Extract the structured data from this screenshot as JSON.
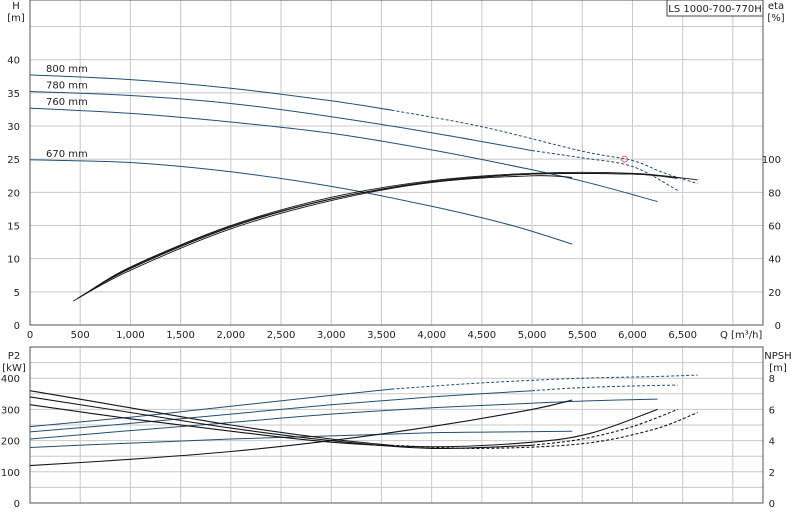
{
  "model_label": "LS 1000-700-770H",
  "colors": {
    "blue": "#1f4f7a",
    "black": "#151515",
    "grid": "#c8c8c8",
    "duty_point": "#e06666"
  },
  "chart_data": [
    {
      "type": "line",
      "name": "head-efficiency",
      "x_label": "Q [m³/h]",
      "x_ticks": [
        "0",
        "500",
        "1,000",
        "1,500",
        "2,000",
        "2,500",
        "3,000",
        "3,500",
        "4,000",
        "4,500",
        "5,000",
        "5,500",
        "6,000",
        "6,500"
      ],
      "xlim": [
        0,
        7300
      ],
      "left_axis": {
        "label_top": "H",
        "label_unit": "[m]",
        "ticks": [
          "0",
          "5",
          "10",
          "15",
          "20",
          "25",
          "30",
          "35",
          "40"
        ],
        "ylim": [
          0,
          49
        ]
      },
      "right_axis": {
        "label_top": "eta",
        "label_unit": "[%]",
        "ticks": [
          "0",
          "20",
          "40",
          "60",
          "80",
          "100"
        ],
        "ylim": [
          0,
          196
        ]
      },
      "grid": true,
      "head_curves": [
        {
          "name": "800 mm",
          "points": [
            [
              0,
              37.7
            ],
            [
              1000,
              37.0
            ],
            [
              2000,
              35.7
            ],
            [
              3000,
              33.8
            ],
            [
              3600,
              32.4
            ],
            [
              4500,
              29.9
            ],
            [
              5500,
              26.2
            ],
            [
              6000,
              24.8
            ],
            [
              6300,
              23.0
            ],
            [
              6650,
              21.3
            ]
          ],
          "solid_until": 3600
        },
        {
          "name": "780 mm",
          "points": [
            [
              0,
              35.2
            ],
            [
              1000,
              34.6
            ],
            [
              2000,
              33.4
            ],
            [
              3000,
              31.4
            ],
            [
              4000,
              29.0
            ],
            [
              5000,
              26.3
            ],
            [
              5500,
              25.2
            ],
            [
              6000,
              23.9
            ],
            [
              6450,
              20.3
            ]
          ],
          "solid_until": 5000
        },
        {
          "name": "760 mm",
          "points": [
            [
              0,
              32.7
            ],
            [
              1000,
              31.9
            ],
            [
              2000,
              30.6
            ],
            [
              3000,
              28.9
            ],
            [
              4000,
              26.4
            ],
            [
              5000,
              23.4
            ],
            [
              5600,
              21.3
            ],
            [
              6250,
              18.6
            ]
          ],
          "solid_until": 6250
        },
        {
          "name": "670 mm",
          "points": [
            [
              0,
              24.9
            ],
            [
              1000,
              24.5
            ],
            [
              2000,
              23.1
            ],
            [
              3000,
              20.9
            ],
            [
              4000,
              17.9
            ],
            [
              4800,
              15.0
            ],
            [
              5400,
              12.2
            ]
          ],
          "solid_until": 5400
        }
      ],
      "efficiency_curves": [
        {
          "name": "",
          "points": [
            [
              430,
              14.5
            ],
            [
              1000,
              33
            ],
            [
              2000,
              58
            ],
            [
              3000,
              75
            ],
            [
              4000,
              86
            ],
            [
              5000,
              90
            ],
            [
              5400,
              89
            ]
          ]
        },
        {
          "name": "",
          "points": [
            [
              470,
              16
            ],
            [
              1000,
              34
            ],
            [
              2000,
              59
            ],
            [
              3000,
              76
            ],
            [
              4000,
              86
            ],
            [
              5000,
              91
            ],
            [
              6000,
              91
            ],
            [
              6250,
              90
            ]
          ]
        },
        {
          "name": "",
          "points": [
            [
              500,
              17
            ],
            [
              1000,
              34.5
            ],
            [
              2000,
              59.5
            ],
            [
              3000,
              76
            ],
            [
              4000,
              86.5
            ],
            [
              5000,
              91
            ],
            [
              6000,
              91
            ],
            [
              6450,
              88.5
            ]
          ]
        },
        {
          "name": "",
          "points": [
            [
              530,
              18
            ],
            [
              1000,
              35
            ],
            [
              2000,
              60
            ],
            [
              3000,
              77
            ],
            [
              4000,
              87
            ],
            [
              5000,
              91.5
            ],
            [
              6000,
              91.5
            ],
            [
              6650,
              87.5
            ]
          ]
        }
      ],
      "duty_point": {
        "x": 5920,
        "y": 25.0
      }
    },
    {
      "type": "line",
      "name": "power-npsh",
      "xlim": [
        0,
        7300
      ],
      "left_axis": {
        "label_top": "P2",
        "label_unit": "[kW]",
        "ticks": [
          "0",
          "100",
          "200",
          "300",
          "400"
        ],
        "ylim": [
          0,
          500
        ]
      },
      "right_axis": {
        "label_top": "NPSH",
        "label_unit": "[m]",
        "ticks": [
          "0",
          "2",
          "4",
          "6",
          "8"
        ],
        "ylim": [
          0,
          10
        ]
      },
      "grid": true,
      "power_curves": [
        {
          "name": "",
          "points": [
            [
              0,
              245
            ],
            [
              1000,
              275
            ],
            [
              2000,
              310
            ],
            [
              3000,
              345
            ],
            [
              3600,
              365
            ],
            [
              4500,
              385
            ],
            [
              5500,
              400
            ],
            [
              6200,
              405
            ],
            [
              6650,
              410
            ]
          ],
          "solid_until": 3600
        },
        {
          "name": "",
          "points": [
            [
              0,
              228
            ],
            [
              1000,
              255
            ],
            [
              2000,
              285
            ],
            [
              3000,
              315
            ],
            [
              4000,
              340
            ],
            [
              5000,
              360
            ],
            [
              5500,
              370
            ],
            [
              6000,
              375
            ],
            [
              6450,
              378
            ]
          ],
          "solid_until": 5000
        },
        {
          "name": "",
          "points": [
            [
              0,
              205
            ],
            [
              1000,
              232
            ],
            [
              2000,
              258
            ],
            [
              3000,
              285
            ],
            [
              4000,
              305
            ],
            [
              5000,
              320
            ],
            [
              5600,
              328
            ],
            [
              6250,
              333
            ]
          ],
          "solid_until": 6250
        },
        {
          "name": "",
          "points": [
            [
              0,
              178
            ],
            [
              1000,
              192
            ],
            [
              2000,
              205
            ],
            [
              3000,
              215
            ],
            [
              4000,
              225
            ],
            [
              4800,
              228
            ],
            [
              5400,
              230
            ]
          ],
          "solid_until": 5400
        }
      ],
      "npsh_curves": [
        {
          "name": "",
          "points": [
            [
              0,
              2.4
            ],
            [
              1000,
              2.8
            ],
            [
              2000,
              3.3
            ],
            [
              3000,
              4.0
            ],
            [
              4000,
              4.9
            ],
            [
              5000,
              6.0
            ],
            [
              5400,
              6.6
            ]
          ],
          "solid_until": 5400
        },
        {
          "name": "",
          "points": [
            [
              0,
              6.3
            ],
            [
              1000,
              5.4
            ],
            [
              2000,
              4.6
            ],
            [
              3000,
              3.9
            ],
            [
              4000,
              3.6
            ],
            [
              5000,
              3.9
            ],
            [
              5600,
              4.5
            ],
            [
              6250,
              6.0
            ]
          ],
          "solid_until": 6250
        },
        {
          "name": "",
          "points": [
            [
              0,
              6.8
            ],
            [
              1000,
              5.8
            ],
            [
              2000,
              4.8
            ],
            [
              3000,
              4.0
            ],
            [
              4000,
              3.5
            ],
            [
              5000,
              3.7
            ],
            [
              5500,
              4.1
            ],
            [
              6000,
              4.9
            ],
            [
              6450,
              6.0
            ]
          ],
          "solid_until": 5000
        },
        {
          "name": "",
          "points": [
            [
              0,
              7.2
            ],
            [
              1000,
              6.1
            ],
            [
              2000,
              5.0
            ],
            [
              3000,
              4.1
            ],
            [
              3600,
              3.7
            ],
            [
              4500,
              3.5
            ],
            [
              5500,
              3.8
            ],
            [
              6200,
              4.7
            ],
            [
              6650,
              5.8
            ]
          ],
          "solid_until": 3600
        }
      ]
    }
  ]
}
